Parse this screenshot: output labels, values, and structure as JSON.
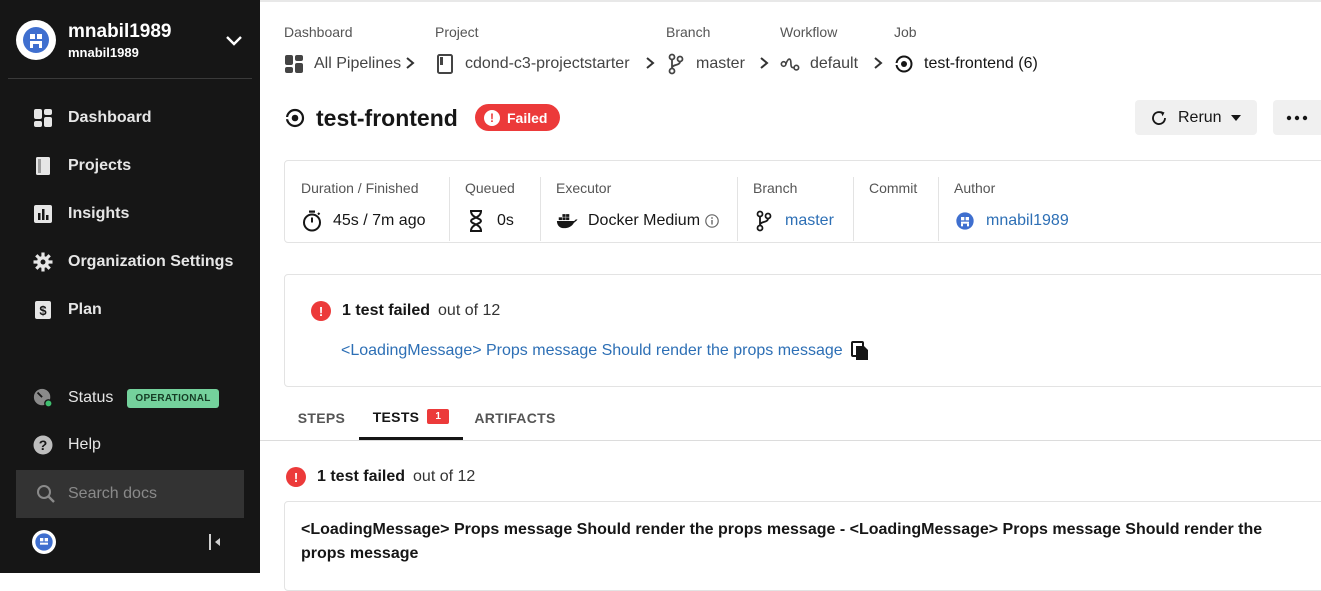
{
  "sidebar": {
    "username": "mnabil1989",
    "org": "mnabil1989",
    "nav": [
      {
        "label": "Dashboard",
        "icon": "dashboard-icon"
      },
      {
        "label": "Projects",
        "icon": "book-icon"
      },
      {
        "label": "Insights",
        "icon": "bar-chart-icon"
      },
      {
        "label": "Organization Settings",
        "icon": "gear-icon"
      },
      {
        "label": "Plan",
        "icon": "dollar-icon"
      }
    ],
    "status_label": "Status",
    "status_badge": "OPERATIONAL",
    "help_label": "Help",
    "search_placeholder": "Search docs"
  },
  "breadcrumb": {
    "labels": [
      "Dashboard",
      "Project",
      "Branch",
      "Workflow",
      "Job"
    ],
    "values": [
      "All Pipelines",
      "cdond-c3-projectstarter",
      "master",
      "default",
      "test-frontend (6)"
    ]
  },
  "job": {
    "title": "test-frontend",
    "status": "Failed",
    "rerun_label": "Rerun"
  },
  "meta": {
    "duration_label": "Duration / Finished",
    "duration_value": "45s / 7m ago",
    "queued_label": "Queued",
    "queued_value": "0s",
    "executor_label": "Executor",
    "executor_value": "Docker Medium",
    "branch_label": "Branch",
    "branch_value": "master",
    "commit_label": "Commit",
    "author_label": "Author",
    "author_value": "mnabil1989"
  },
  "summary": {
    "failed_text": "1 test failed",
    "out_of_text": "out of 12",
    "test_name": "<LoadingMessage> Props message Should render the props message"
  },
  "tabs": [
    {
      "label": "STEPS"
    },
    {
      "label": "TESTS",
      "count": "1"
    },
    {
      "label": "ARTIFACTS"
    }
  ],
  "tests": {
    "failed_text": "1 test failed",
    "out_of_text": "out of 12",
    "result_title": "<LoadingMessage> Props message Should render the props message - <LoadingMessage> Props message Should render the props message"
  },
  "colors": {
    "sidebar_bg": "#161616",
    "failed_red": "#ec3a3a",
    "link_blue": "#2d6fb5",
    "operational_green": "#74d19c"
  }
}
